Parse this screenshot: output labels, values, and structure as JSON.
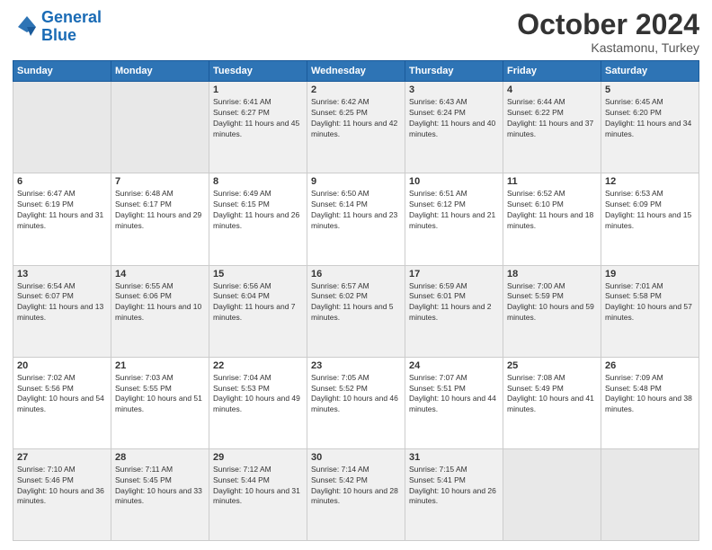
{
  "logo": {
    "line1": "General",
    "line2": "Blue"
  },
  "title": "October 2024",
  "subtitle": "Kastamonu, Turkey",
  "days_header": [
    "Sunday",
    "Monday",
    "Tuesday",
    "Wednesday",
    "Thursday",
    "Friday",
    "Saturday"
  ],
  "weeks": [
    [
      {
        "num": "",
        "sunrise": "",
        "sunset": "",
        "daylight": ""
      },
      {
        "num": "",
        "sunrise": "",
        "sunset": "",
        "daylight": ""
      },
      {
        "num": "1",
        "sunrise": "Sunrise: 6:41 AM",
        "sunset": "Sunset: 6:27 PM",
        "daylight": "Daylight: 11 hours and 45 minutes."
      },
      {
        "num": "2",
        "sunrise": "Sunrise: 6:42 AM",
        "sunset": "Sunset: 6:25 PM",
        "daylight": "Daylight: 11 hours and 42 minutes."
      },
      {
        "num": "3",
        "sunrise": "Sunrise: 6:43 AM",
        "sunset": "Sunset: 6:24 PM",
        "daylight": "Daylight: 11 hours and 40 minutes."
      },
      {
        "num": "4",
        "sunrise": "Sunrise: 6:44 AM",
        "sunset": "Sunset: 6:22 PM",
        "daylight": "Daylight: 11 hours and 37 minutes."
      },
      {
        "num": "5",
        "sunrise": "Sunrise: 6:45 AM",
        "sunset": "Sunset: 6:20 PM",
        "daylight": "Daylight: 11 hours and 34 minutes."
      }
    ],
    [
      {
        "num": "6",
        "sunrise": "Sunrise: 6:47 AM",
        "sunset": "Sunset: 6:19 PM",
        "daylight": "Daylight: 11 hours and 31 minutes."
      },
      {
        "num": "7",
        "sunrise": "Sunrise: 6:48 AM",
        "sunset": "Sunset: 6:17 PM",
        "daylight": "Daylight: 11 hours and 29 minutes."
      },
      {
        "num": "8",
        "sunrise": "Sunrise: 6:49 AM",
        "sunset": "Sunset: 6:15 PM",
        "daylight": "Daylight: 11 hours and 26 minutes."
      },
      {
        "num": "9",
        "sunrise": "Sunrise: 6:50 AM",
        "sunset": "Sunset: 6:14 PM",
        "daylight": "Daylight: 11 hours and 23 minutes."
      },
      {
        "num": "10",
        "sunrise": "Sunrise: 6:51 AM",
        "sunset": "Sunset: 6:12 PM",
        "daylight": "Daylight: 11 hours and 21 minutes."
      },
      {
        "num": "11",
        "sunrise": "Sunrise: 6:52 AM",
        "sunset": "Sunset: 6:10 PM",
        "daylight": "Daylight: 11 hours and 18 minutes."
      },
      {
        "num": "12",
        "sunrise": "Sunrise: 6:53 AM",
        "sunset": "Sunset: 6:09 PM",
        "daylight": "Daylight: 11 hours and 15 minutes."
      }
    ],
    [
      {
        "num": "13",
        "sunrise": "Sunrise: 6:54 AM",
        "sunset": "Sunset: 6:07 PM",
        "daylight": "Daylight: 11 hours and 13 minutes."
      },
      {
        "num": "14",
        "sunrise": "Sunrise: 6:55 AM",
        "sunset": "Sunset: 6:06 PM",
        "daylight": "Daylight: 11 hours and 10 minutes."
      },
      {
        "num": "15",
        "sunrise": "Sunrise: 6:56 AM",
        "sunset": "Sunset: 6:04 PM",
        "daylight": "Daylight: 11 hours and 7 minutes."
      },
      {
        "num": "16",
        "sunrise": "Sunrise: 6:57 AM",
        "sunset": "Sunset: 6:02 PM",
        "daylight": "Daylight: 11 hours and 5 minutes."
      },
      {
        "num": "17",
        "sunrise": "Sunrise: 6:59 AM",
        "sunset": "Sunset: 6:01 PM",
        "daylight": "Daylight: 11 hours and 2 minutes."
      },
      {
        "num": "18",
        "sunrise": "Sunrise: 7:00 AM",
        "sunset": "Sunset: 5:59 PM",
        "daylight": "Daylight: 10 hours and 59 minutes."
      },
      {
        "num": "19",
        "sunrise": "Sunrise: 7:01 AM",
        "sunset": "Sunset: 5:58 PM",
        "daylight": "Daylight: 10 hours and 57 minutes."
      }
    ],
    [
      {
        "num": "20",
        "sunrise": "Sunrise: 7:02 AM",
        "sunset": "Sunset: 5:56 PM",
        "daylight": "Daylight: 10 hours and 54 minutes."
      },
      {
        "num": "21",
        "sunrise": "Sunrise: 7:03 AM",
        "sunset": "Sunset: 5:55 PM",
        "daylight": "Daylight: 10 hours and 51 minutes."
      },
      {
        "num": "22",
        "sunrise": "Sunrise: 7:04 AM",
        "sunset": "Sunset: 5:53 PM",
        "daylight": "Daylight: 10 hours and 49 minutes."
      },
      {
        "num": "23",
        "sunrise": "Sunrise: 7:05 AM",
        "sunset": "Sunset: 5:52 PM",
        "daylight": "Daylight: 10 hours and 46 minutes."
      },
      {
        "num": "24",
        "sunrise": "Sunrise: 7:07 AM",
        "sunset": "Sunset: 5:51 PM",
        "daylight": "Daylight: 10 hours and 44 minutes."
      },
      {
        "num": "25",
        "sunrise": "Sunrise: 7:08 AM",
        "sunset": "Sunset: 5:49 PM",
        "daylight": "Daylight: 10 hours and 41 minutes."
      },
      {
        "num": "26",
        "sunrise": "Sunrise: 7:09 AM",
        "sunset": "Sunset: 5:48 PM",
        "daylight": "Daylight: 10 hours and 38 minutes."
      }
    ],
    [
      {
        "num": "27",
        "sunrise": "Sunrise: 7:10 AM",
        "sunset": "Sunset: 5:46 PM",
        "daylight": "Daylight: 10 hours and 36 minutes."
      },
      {
        "num": "28",
        "sunrise": "Sunrise: 7:11 AM",
        "sunset": "Sunset: 5:45 PM",
        "daylight": "Daylight: 10 hours and 33 minutes."
      },
      {
        "num": "29",
        "sunrise": "Sunrise: 7:12 AM",
        "sunset": "Sunset: 5:44 PM",
        "daylight": "Daylight: 10 hours and 31 minutes."
      },
      {
        "num": "30",
        "sunrise": "Sunrise: 7:14 AM",
        "sunset": "Sunset: 5:42 PM",
        "daylight": "Daylight: 10 hours and 28 minutes."
      },
      {
        "num": "31",
        "sunrise": "Sunrise: 7:15 AM",
        "sunset": "Sunset: 5:41 PM",
        "daylight": "Daylight: 10 hours and 26 minutes."
      },
      {
        "num": "",
        "sunrise": "",
        "sunset": "",
        "daylight": ""
      },
      {
        "num": "",
        "sunrise": "",
        "sunset": "",
        "daylight": ""
      }
    ]
  ]
}
